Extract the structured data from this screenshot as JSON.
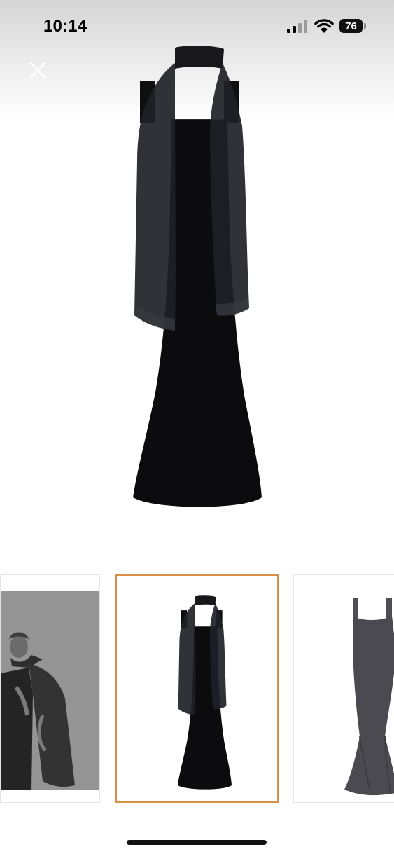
{
  "status_bar": {
    "time": "10:14",
    "battery_level": "76",
    "icons": [
      "cellular-signal-icon",
      "wifi-icon",
      "battery-icon"
    ]
  },
  "viewer": {
    "close_icon": "close-icon",
    "main_image": "black-gown-with-sheer-scarf",
    "thumbnails": [
      {
        "image": "model-wearing-black-gown-grayscale",
        "selected": false
      },
      {
        "image": "black-gown-with-sheer-scarf",
        "selected": true
      },
      {
        "image": "black-mermaid-gown-side-view",
        "selected": false
      }
    ]
  },
  "colors": {
    "selected_thumbnail_border": "#d9914a",
    "thumbnail_border": "#e4e4e4",
    "garment": "#0d0d0f",
    "scarf": "#1c1c22"
  }
}
